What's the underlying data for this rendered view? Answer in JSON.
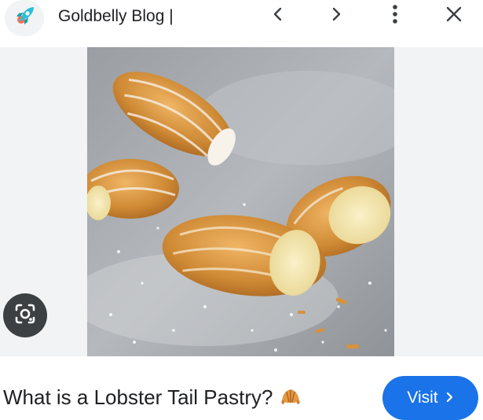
{
  "header": {
    "site_name": "Goldbelly Blog |",
    "favicon_icon": "rocket-icon",
    "prev_icon": "chevron-left-icon",
    "next_icon": "chevron-right-icon",
    "more_icon": "more-vertical-icon",
    "close_icon": "close-icon"
  },
  "image": {
    "background_color": "#f1f3f4",
    "lens_icon": "google-lens-icon"
  },
  "result": {
    "title": "What is a Lobster Tail Pastry?",
    "title_emoji": "croissant-icon",
    "visit_label": "Visit",
    "visit_icon": "chevron-right-icon",
    "accent_color": "#1a73e8"
  }
}
